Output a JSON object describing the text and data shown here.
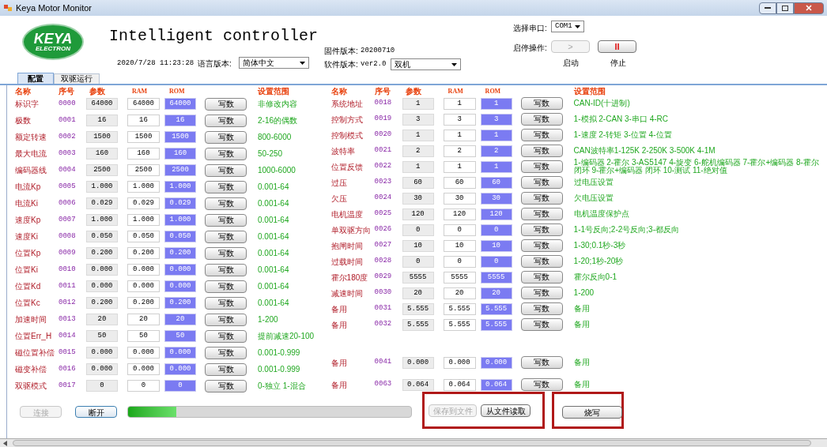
{
  "window": {
    "title": "Keya Motor Monitor"
  },
  "header": {
    "logo": {
      "line1": "KEYA",
      "line2": "ELECTRON"
    },
    "title": "Intelligent controller",
    "datetime": "2020/7/28 11:23:28",
    "language_label": "语言版本:",
    "language_select": "简体中文",
    "firmware_label": "固件版本:",
    "firmware_value": "20200710",
    "software_label": "软件版本:",
    "software_value": "ver2.0",
    "mode_select": "双机",
    "port_label": "选择串口:",
    "port_select": "COM1",
    "startstop_label": "启停操作:",
    "start_button": {
      "label": ">",
      "disabled": true
    },
    "stop_button": {
      "label": "II",
      "disabled": false
    },
    "start_caption": "启动",
    "stop_caption": "停止"
  },
  "tabs": [
    {
      "label": "配置",
      "selected": true
    },
    {
      "label": "双驱运行",
      "selected": false
    }
  ],
  "left_table": {
    "columns": [
      "名称",
      "序号",
      "参数",
      "RAM",
      "ROM",
      "设置范围"
    ],
    "rows": [
      {
        "name": "标识字",
        "code": "0000",
        "param": "64000",
        "ram": "64000",
        "rom": "64000",
        "button": "写数",
        "range": "非修改内容"
      },
      {
        "name": "极数",
        "code": "0001",
        "param": "16",
        "ram": "16",
        "rom": "16",
        "button": "写数",
        "range": "2-16的偶数"
      },
      {
        "name": "额定转速",
        "code": "0002",
        "param": "1500",
        "ram": "1500",
        "rom": "1500",
        "button": "写数",
        "range": "800-6000"
      },
      {
        "name": "最大电流",
        "code": "0003",
        "param": "160",
        "ram": "160",
        "rom": "160",
        "button": "写数",
        "range": "50-250"
      },
      {
        "name": "编码器线",
        "code": "0004",
        "param": "2500",
        "ram": "2500",
        "rom": "2500",
        "button": "写数",
        "range": "1000-6000"
      },
      {
        "name": "电流Kp",
        "code": "0005",
        "param": "1.000",
        "ram": "1.000",
        "rom": "1.000",
        "button": "写数",
        "range": "0.001-64"
      },
      {
        "name": "电流Ki",
        "code": "0006",
        "param": "0.029",
        "ram": "0.029",
        "rom": "0.029",
        "button": "写数",
        "range": "0.001-64"
      },
      {
        "name": "速度Kp",
        "code": "0007",
        "param": "1.000",
        "ram": "1.000",
        "rom": "1.000",
        "button": "写数",
        "range": "0.001-64"
      },
      {
        "name": "速度Ki",
        "code": "0008",
        "param": "0.050",
        "ram": "0.050",
        "rom": "0.050",
        "button": "写数",
        "range": "0.001-64"
      },
      {
        "name": "位置Kp",
        "code": "0009",
        "param": "0.200",
        "ram": "0.200",
        "rom": "0.200",
        "button": "写数",
        "range": "0.001-64"
      },
      {
        "name": "位置Ki",
        "code": "0010",
        "param": "0.000",
        "ram": "0.000",
        "rom": "0.000",
        "button": "写数",
        "range": "0.001-64"
      },
      {
        "name": "位置Kd",
        "code": "0011",
        "param": "0.000",
        "ram": "0.000",
        "rom": "0.000",
        "button": "写数",
        "range": "0.001-64"
      },
      {
        "name": "位置Kc",
        "code": "0012",
        "param": "0.200",
        "ram": "0.200",
        "rom": "0.200",
        "button": "写数",
        "range": "0.001-64"
      },
      {
        "name": "加速时间",
        "code": "0013",
        "param": "20",
        "ram": "20",
        "rom": "20",
        "button": "写数",
        "range": "1-200"
      },
      {
        "name": "位置Err_H",
        "code": "0014",
        "param": "50",
        "ram": "50",
        "rom": "50",
        "button": "写数",
        "range": "提前减速20-100"
      },
      {
        "name": "磁位置补偿",
        "code": "0015",
        "param": "0.000",
        "ram": "0.000",
        "rom": "0.000",
        "button": "写数",
        "range": "0.001-0.999"
      },
      {
        "name": "磁变补偿",
        "code": "0016",
        "param": "0.000",
        "ram": "0.000",
        "rom": "0.000",
        "button": "写数",
        "range": "0.001-0.999"
      },
      {
        "name": "双驱模式",
        "code": "0017",
        "param": "0",
        "ram": "0",
        "rom": "0",
        "button": "写数",
        "range": "0-独立 1-混合"
      }
    ]
  },
  "right_table": {
    "columns": [
      "名称",
      "序号",
      "参数",
      "RAM",
      "ROM",
      "设置范围"
    ],
    "rows": [
      {
        "name": "系统地址",
        "code": "0018",
        "param": "1",
        "ram": "1",
        "rom": "1",
        "button": "写数",
        "range": "CAN-ID(十进制)"
      },
      {
        "name": "控制方式",
        "code": "0019",
        "param": "3",
        "ram": "3",
        "rom": "3",
        "button": "写数",
        "range": "1-模拟 2-CAN 3-串口 4-RC"
      },
      {
        "name": "控制模式",
        "code": "0020",
        "param": "1",
        "ram": "1",
        "rom": "1",
        "button": "写数",
        "range": "1-速度 2-转矩 3-位置 4-位置"
      },
      {
        "name": "波特率",
        "code": "0021",
        "param": "2",
        "ram": "2",
        "rom": "2",
        "button": "写数",
        "range": "CAN波特率1-125K 2-250K 3-500K 4-1M"
      },
      {
        "name": "位置反馈",
        "code": "0022",
        "param": "1",
        "ram": "1",
        "rom": "1",
        "button": "写数",
        "range": "1-编码器 2-霍尔 3-AS5147 4-旋变 6-舵机编码器 7-霍尔+编码器 8-霍尔闭环 9-霍尔+编码器 闭环 10-测试 11-绝对值"
      },
      {
        "name": "过压",
        "code": "0023",
        "param": "60",
        "ram": "60",
        "rom": "60",
        "button": "写数",
        "range": "过电压设置"
      },
      {
        "name": "欠压",
        "code": "0024",
        "param": "30",
        "ram": "30",
        "rom": "30",
        "button": "写数",
        "range": "欠电压设置"
      },
      {
        "name": "电机温度",
        "code": "0025",
        "param": "120",
        "ram": "120",
        "rom": "120",
        "button": "写数",
        "range": "电机温度保护点"
      },
      {
        "name": "单双驱方向",
        "code": "0026",
        "param": "0",
        "ram": "0",
        "rom": "0",
        "button": "写数",
        "range": "1-1号反向;2-2号反向;3-都反向"
      },
      {
        "name": "抱闸时间",
        "code": "0027",
        "param": "10",
        "ram": "10",
        "rom": "10",
        "button": "写数",
        "range": "1-30;0.1秒-3秒"
      },
      {
        "name": "过载时间",
        "code": "0028",
        "param": "0",
        "ram": "0",
        "rom": "0",
        "button": "写数",
        "range": "1-20;1秒-20秒"
      },
      {
        "name": "霍尔180度",
        "code": "0029",
        "param": "5555",
        "ram": "5555",
        "rom": "5555",
        "button": "写数",
        "range": "霍尔反向0-1"
      },
      {
        "name": "减速时间",
        "code": "0030",
        "param": "20",
        "ram": "20",
        "rom": "20",
        "button": "写数",
        "range": "1-200"
      },
      {
        "name": "备用",
        "code": "0031",
        "param": "5.555",
        "ram": "5.555",
        "rom": "5.555",
        "button": "写数",
        "range": "备用"
      },
      {
        "name": "备用",
        "code": "0032",
        "param": "5.555",
        "ram": "5.555",
        "rom": "5.555",
        "button": "写数",
        "range": "备用"
      },
      {
        "name": "备用",
        "code": "0041",
        "param": "0.000",
        "ram": "0.000",
        "rom": "0.000",
        "button": "写数",
        "range": "备用"
      },
      {
        "name": "备用",
        "code": "0063",
        "param": "0.064",
        "ram": "0.064",
        "rom": "0.064",
        "button": "写数",
        "range": "备用"
      }
    ]
  },
  "footer": {
    "connect_button": {
      "label": "连接",
      "disabled": true
    },
    "disconnect_button": {
      "label": "断开",
      "disabled": false
    },
    "progress": {
      "level": 0.17
    },
    "save_button": {
      "label": "保存到文件",
      "disabled": true
    },
    "load_button": {
      "label": "从文件读取",
      "disabled": false
    },
    "burn_button": {
      "label": "烧写",
      "disabled": false
    }
  }
}
